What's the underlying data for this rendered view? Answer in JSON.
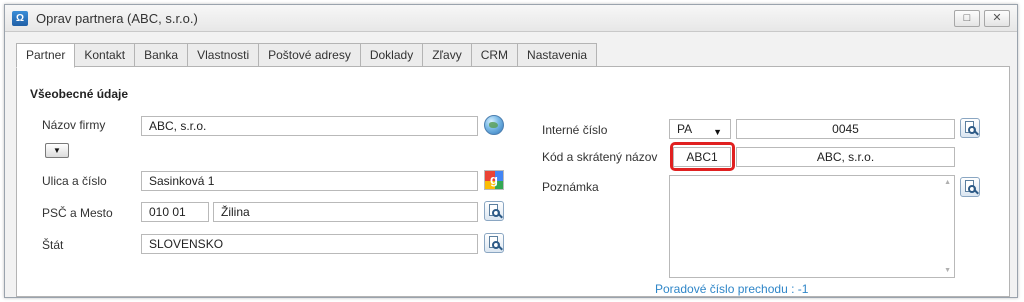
{
  "window": {
    "title": "Oprav partnera (ABC, s.r.o.)",
    "restore_icon": "□",
    "close_icon": "✕"
  },
  "tabs": [
    {
      "label": "Partner",
      "active": true
    },
    {
      "label": "Kontakt"
    },
    {
      "label": "Banka"
    },
    {
      "label": "Vlastnosti"
    },
    {
      "label": "Poštové adresy"
    },
    {
      "label": "Doklady"
    },
    {
      "label": "Zľavy"
    },
    {
      "label": "CRM"
    },
    {
      "label": "Nastavenia"
    }
  ],
  "section": {
    "title": "Všeobecné údaje"
  },
  "left": {
    "company_label": "Názov firmy",
    "company_value": "ABC, s.r.o.",
    "street_label": "Ulica a číslo",
    "street_value": "Sasinková 1",
    "zip_city_label": "PSČ a Mesto",
    "zip_value": "010 01",
    "city_value": "Žilina",
    "country_label": "Štát",
    "country_value": "SLOVENSKO"
  },
  "right": {
    "internal_number_label": "Interné číslo",
    "prefix_value": "PA",
    "number_value": "0045",
    "code_label": "Kód a skrátený názov",
    "code_value": "ABC1",
    "short_name_value": "ABC, s.r.o.",
    "note_label": "Poznámka",
    "note_value": "",
    "sequence_text": "Poradové číslo prechodu : -1"
  },
  "icons": {
    "app": "partner-app-icon",
    "globe": "globe-icon",
    "maps": "google-maps-icon",
    "lookup": "lookup-icon"
  },
  "colors": {
    "highlight": "#e02020",
    "link": "#2f86c8"
  }
}
